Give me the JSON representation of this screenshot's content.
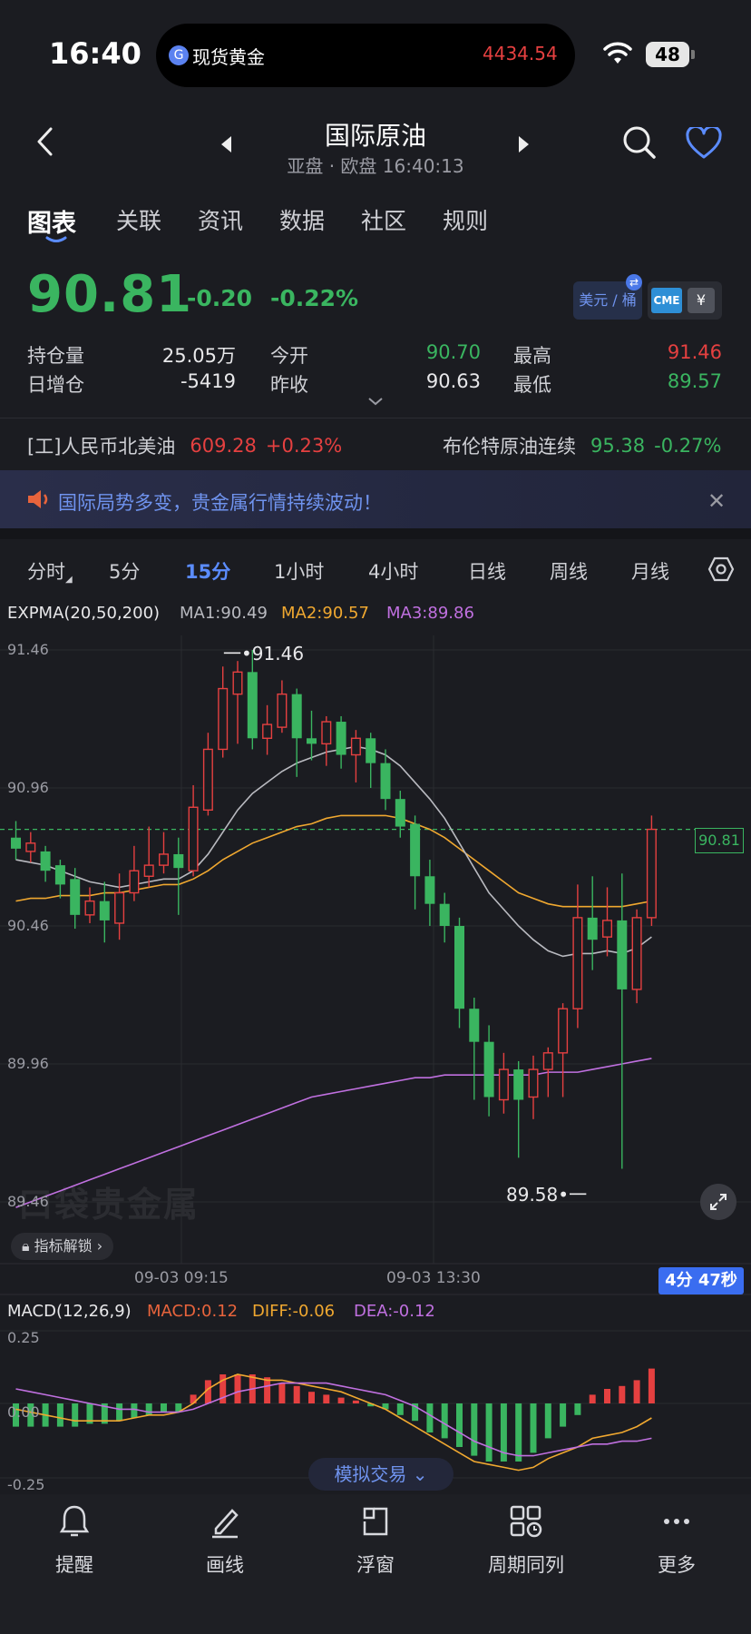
{
  "status_bar": {
    "time": "16:40",
    "island_name": "现货黄金",
    "island_price": "4434.54",
    "battery": "48"
  },
  "header": {
    "title": "国际原油",
    "subtitle": "亚盘 · 欧盘 16:40:13"
  },
  "tabs": [
    "图表",
    "关联",
    "资讯",
    "数据",
    "社区",
    "规则"
  ],
  "quote": {
    "price": "90.81",
    "change": "-0.20",
    "change_pct": "-0.22%",
    "unit": "美元 / 桶",
    "exchange": "CME",
    "stats": {
      "open_interest_label": "持仓量",
      "open_interest": "25.05万",
      "daily_change_label": "日增仓",
      "daily_change": "-5419",
      "open_label": "今开",
      "open": "90.70",
      "prev_close_label": "昨收",
      "prev_close": "90.63",
      "high_label": "最高",
      "high": "91.46",
      "low_label": "最低",
      "low": "89.57"
    }
  },
  "related": {
    "left_name": "[工]人民币北美油",
    "left_price": "609.28",
    "left_pct": "+0.23%",
    "right_name": "布伦特原油连续",
    "right_price": "95.38",
    "right_pct": "-0.27%"
  },
  "banner": {
    "text": "国际局势多变，贵金属行情持续波动！"
  },
  "periods": [
    "分时",
    "5分",
    "15分",
    "1小时",
    "4小时",
    "日线",
    "周线",
    "月线"
  ],
  "indicator": {
    "name": "EXPMA(20,50,200)",
    "ma1": "MA1:90.49",
    "ma2": "MA2:90.57",
    "ma3": "MA3:89.86"
  },
  "price_axis": [
    "91.46",
    "90.96",
    "90.46",
    "89.96",
    "89.46"
  ],
  "chart_marks": {
    "high": "91.46",
    "low": "89.58",
    "current": "90.81"
  },
  "time_axis": [
    "09-03 09:15",
    "09-03 13:30"
  ],
  "watermark": "口袋贵金属",
  "unlock_label": "指标解锁",
  "countdown": "4分 47秒",
  "macd": {
    "name": "MACD(12,26,9)",
    "macd": "MACD:0.12",
    "diff": "DIFF:-0.06",
    "dea": "DEA:-0.12",
    "axis": [
      "0.25",
      "0.00",
      "-0.25"
    ]
  },
  "sim_trade": "模拟交易",
  "bottom_nav": [
    "提醒",
    "画线",
    "浮窗",
    "周期同列",
    "更多"
  ],
  "colors": {
    "up": "#e54040",
    "down": "#3ab560",
    "accent": "#5b8cff",
    "ma1": "#b9bac0",
    "ma2": "#f0a830",
    "ma3": "#c070e0"
  },
  "chart_data": {
    "type": "candlestick",
    "price_range": [
      89.46,
      91.46
    ],
    "candles": [
      [
        90.78,
        90.74,
        90.84,
        90.7
      ],
      [
        90.73,
        90.76,
        90.8,
        90.69
      ],
      [
        90.73,
        90.66,
        90.75,
        90.62
      ],
      [
        90.68,
        90.61,
        90.7,
        90.56
      ],
      [
        90.63,
        90.5,
        90.67,
        90.45
      ],
      [
        90.5,
        90.55,
        90.6,
        90.47
      ],
      [
        90.55,
        90.48,
        90.62,
        90.4
      ],
      [
        90.47,
        90.58,
        90.65,
        90.41
      ],
      [
        90.58,
        90.66,
        90.75,
        90.55
      ],
      [
        90.64,
        90.68,
        90.82,
        90.6
      ],
      [
        90.68,
        90.72,
        90.8,
        90.65
      ],
      [
        90.72,
        90.67,
        90.78,
        90.5
      ],
      [
        90.66,
        90.89,
        90.97,
        90.64
      ],
      [
        90.88,
        91.1,
        91.16,
        90.86
      ],
      [
        91.1,
        91.32,
        91.4,
        91.07
      ],
      [
        91.3,
        91.38,
        91.42,
        91.12
      ],
      [
        91.38,
        91.14,
        91.46,
        91.1
      ],
      [
        91.14,
        91.19,
        91.26,
        91.08
      ],
      [
        91.18,
        91.3,
        91.35,
        91.16
      ],
      [
        91.3,
        91.14,
        91.32,
        91.0
      ],
      [
        91.14,
        91.12,
        91.24,
        91.06
      ],
      [
        91.12,
        91.2,
        91.22,
        91.04
      ],
      [
        91.2,
        91.08,
        91.22,
        91.03
      ],
      [
        91.08,
        91.14,
        91.17,
        90.98
      ],
      [
        91.14,
        91.05,
        91.16,
        90.96
      ],
      [
        91.05,
        90.92,
        91.1,
        90.88
      ],
      [
        90.92,
        90.82,
        90.95,
        90.78
      ],
      [
        90.83,
        90.64,
        90.86,
        90.52
      ],
      [
        90.64,
        90.54,
        90.7,
        90.46
      ],
      [
        90.54,
        90.46,
        90.58,
        90.4
      ],
      [
        90.46,
        90.16,
        90.49,
        90.09
      ],
      [
        90.16,
        90.04,
        90.2,
        89.83
      ],
      [
        90.04,
        89.84,
        90.1,
        89.77
      ],
      [
        89.83,
        89.94,
        90.0,
        89.78
      ],
      [
        89.94,
        89.83,
        89.97,
        89.62
      ],
      [
        89.84,
        89.94,
        89.99,
        89.76
      ],
      [
        89.94,
        90.0,
        90.02,
        89.84
      ],
      [
        90.0,
        90.16,
        90.18,
        89.84
      ],
      [
        90.16,
        90.49,
        90.61,
        90.09
      ],
      [
        90.49,
        90.41,
        90.64,
        90.3
      ],
      [
        90.42,
        90.48,
        90.6,
        90.35
      ],
      [
        90.48,
        90.23,
        90.65,
        89.58
      ],
      [
        90.23,
        90.49,
        90.52,
        90.18
      ],
      [
        90.49,
        90.81,
        90.86,
        90.46
      ]
    ],
    "ma1": [
      90.7,
      90.69,
      90.68,
      90.66,
      90.64,
      90.62,
      90.61,
      90.6,
      90.61,
      90.62,
      90.63,
      90.63,
      90.66,
      90.72,
      90.8,
      90.88,
      90.94,
      90.98,
      91.02,
      91.05,
      91.07,
      91.09,
      91.1,
      91.11,
      91.1,
      91.08,
      91.04,
      90.98,
      90.92,
      90.85,
      90.76,
      90.67,
      90.58,
      90.52,
      90.46,
      90.41,
      90.37,
      90.35,
      90.36,
      90.36,
      90.37,
      90.36,
      90.38,
      90.42
    ],
    "ma2": [
      90.55,
      90.56,
      90.56,
      90.57,
      90.57,
      90.57,
      90.58,
      90.58,
      90.59,
      90.6,
      90.61,
      90.61,
      90.63,
      90.66,
      90.7,
      90.73,
      90.76,
      90.78,
      90.8,
      90.82,
      90.83,
      90.85,
      90.86,
      90.86,
      90.86,
      90.86,
      90.85,
      90.83,
      90.81,
      90.78,
      90.74,
      90.7,
      90.66,
      90.62,
      90.58,
      90.56,
      90.54,
      90.53,
      90.53,
      90.53,
      90.53,
      90.53,
      90.54,
      90.55
    ],
    "ma3": [
      89.44,
      89.46,
      89.48,
      89.5,
      89.52,
      89.54,
      89.56,
      89.58,
      89.6,
      89.62,
      89.64,
      89.66,
      89.68,
      89.7,
      89.72,
      89.74,
      89.76,
      89.78,
      89.8,
      89.82,
      89.84,
      89.85,
      89.86,
      89.87,
      89.88,
      89.89,
      89.9,
      89.91,
      89.91,
      89.92,
      89.92,
      89.92,
      89.92,
      89.92,
      89.92,
      89.92,
      89.93,
      89.93,
      89.93,
      89.94,
      89.95,
      89.96,
      89.97,
      89.98
    ],
    "macd_hist": [
      -0.08,
      -0.08,
      -0.08,
      -0.08,
      -0.08,
      -0.07,
      -0.07,
      -0.06,
      -0.05,
      -0.04,
      -0.03,
      -0.03,
      0.03,
      0.08,
      0.1,
      0.1,
      0.1,
      0.09,
      0.07,
      0.06,
      0.04,
      0.03,
      0.02,
      0.01,
      -0.01,
      -0.02,
      -0.04,
      -0.06,
      -0.1,
      -0.12,
      -0.15,
      -0.18,
      -0.2,
      -0.2,
      -0.2,
      -0.17,
      -0.12,
      -0.08,
      -0.04,
      0.03,
      0.05,
      0.06,
      0.08,
      0.12
    ],
    "macd_diff": [
      -0.02,
      -0.03,
      -0.04,
      -0.05,
      -0.06,
      -0.06,
      -0.06,
      -0.06,
      -0.05,
      -0.04,
      -0.04,
      -0.03,
      0.0,
      0.05,
      0.08,
      0.1,
      0.09,
      0.08,
      0.08,
      0.07,
      0.06,
      0.05,
      0.04,
      0.02,
      0.0,
      -0.02,
      -0.05,
      -0.08,
      -0.11,
      -0.14,
      -0.17,
      -0.2,
      -0.21,
      -0.22,
      -0.23,
      -0.22,
      -0.19,
      -0.17,
      -0.15,
      -0.12,
      -0.11,
      -0.1,
      -0.08,
      -0.05
    ],
    "macd_dea": [
      0.05,
      0.04,
      0.03,
      0.02,
      0.01,
      0.0,
      -0.01,
      -0.02,
      -0.02,
      -0.03,
      -0.03,
      -0.03,
      -0.02,
      0.0,
      0.02,
      0.04,
      0.05,
      0.06,
      0.07,
      0.07,
      0.07,
      0.07,
      0.06,
      0.05,
      0.04,
      0.03,
      0.01,
      -0.01,
      -0.04,
      -0.07,
      -0.1,
      -0.13,
      -0.15,
      -0.17,
      -0.18,
      -0.18,
      -0.17,
      -0.16,
      -0.15,
      -0.14,
      -0.14,
      -0.13,
      -0.13,
      -0.12
    ]
  }
}
